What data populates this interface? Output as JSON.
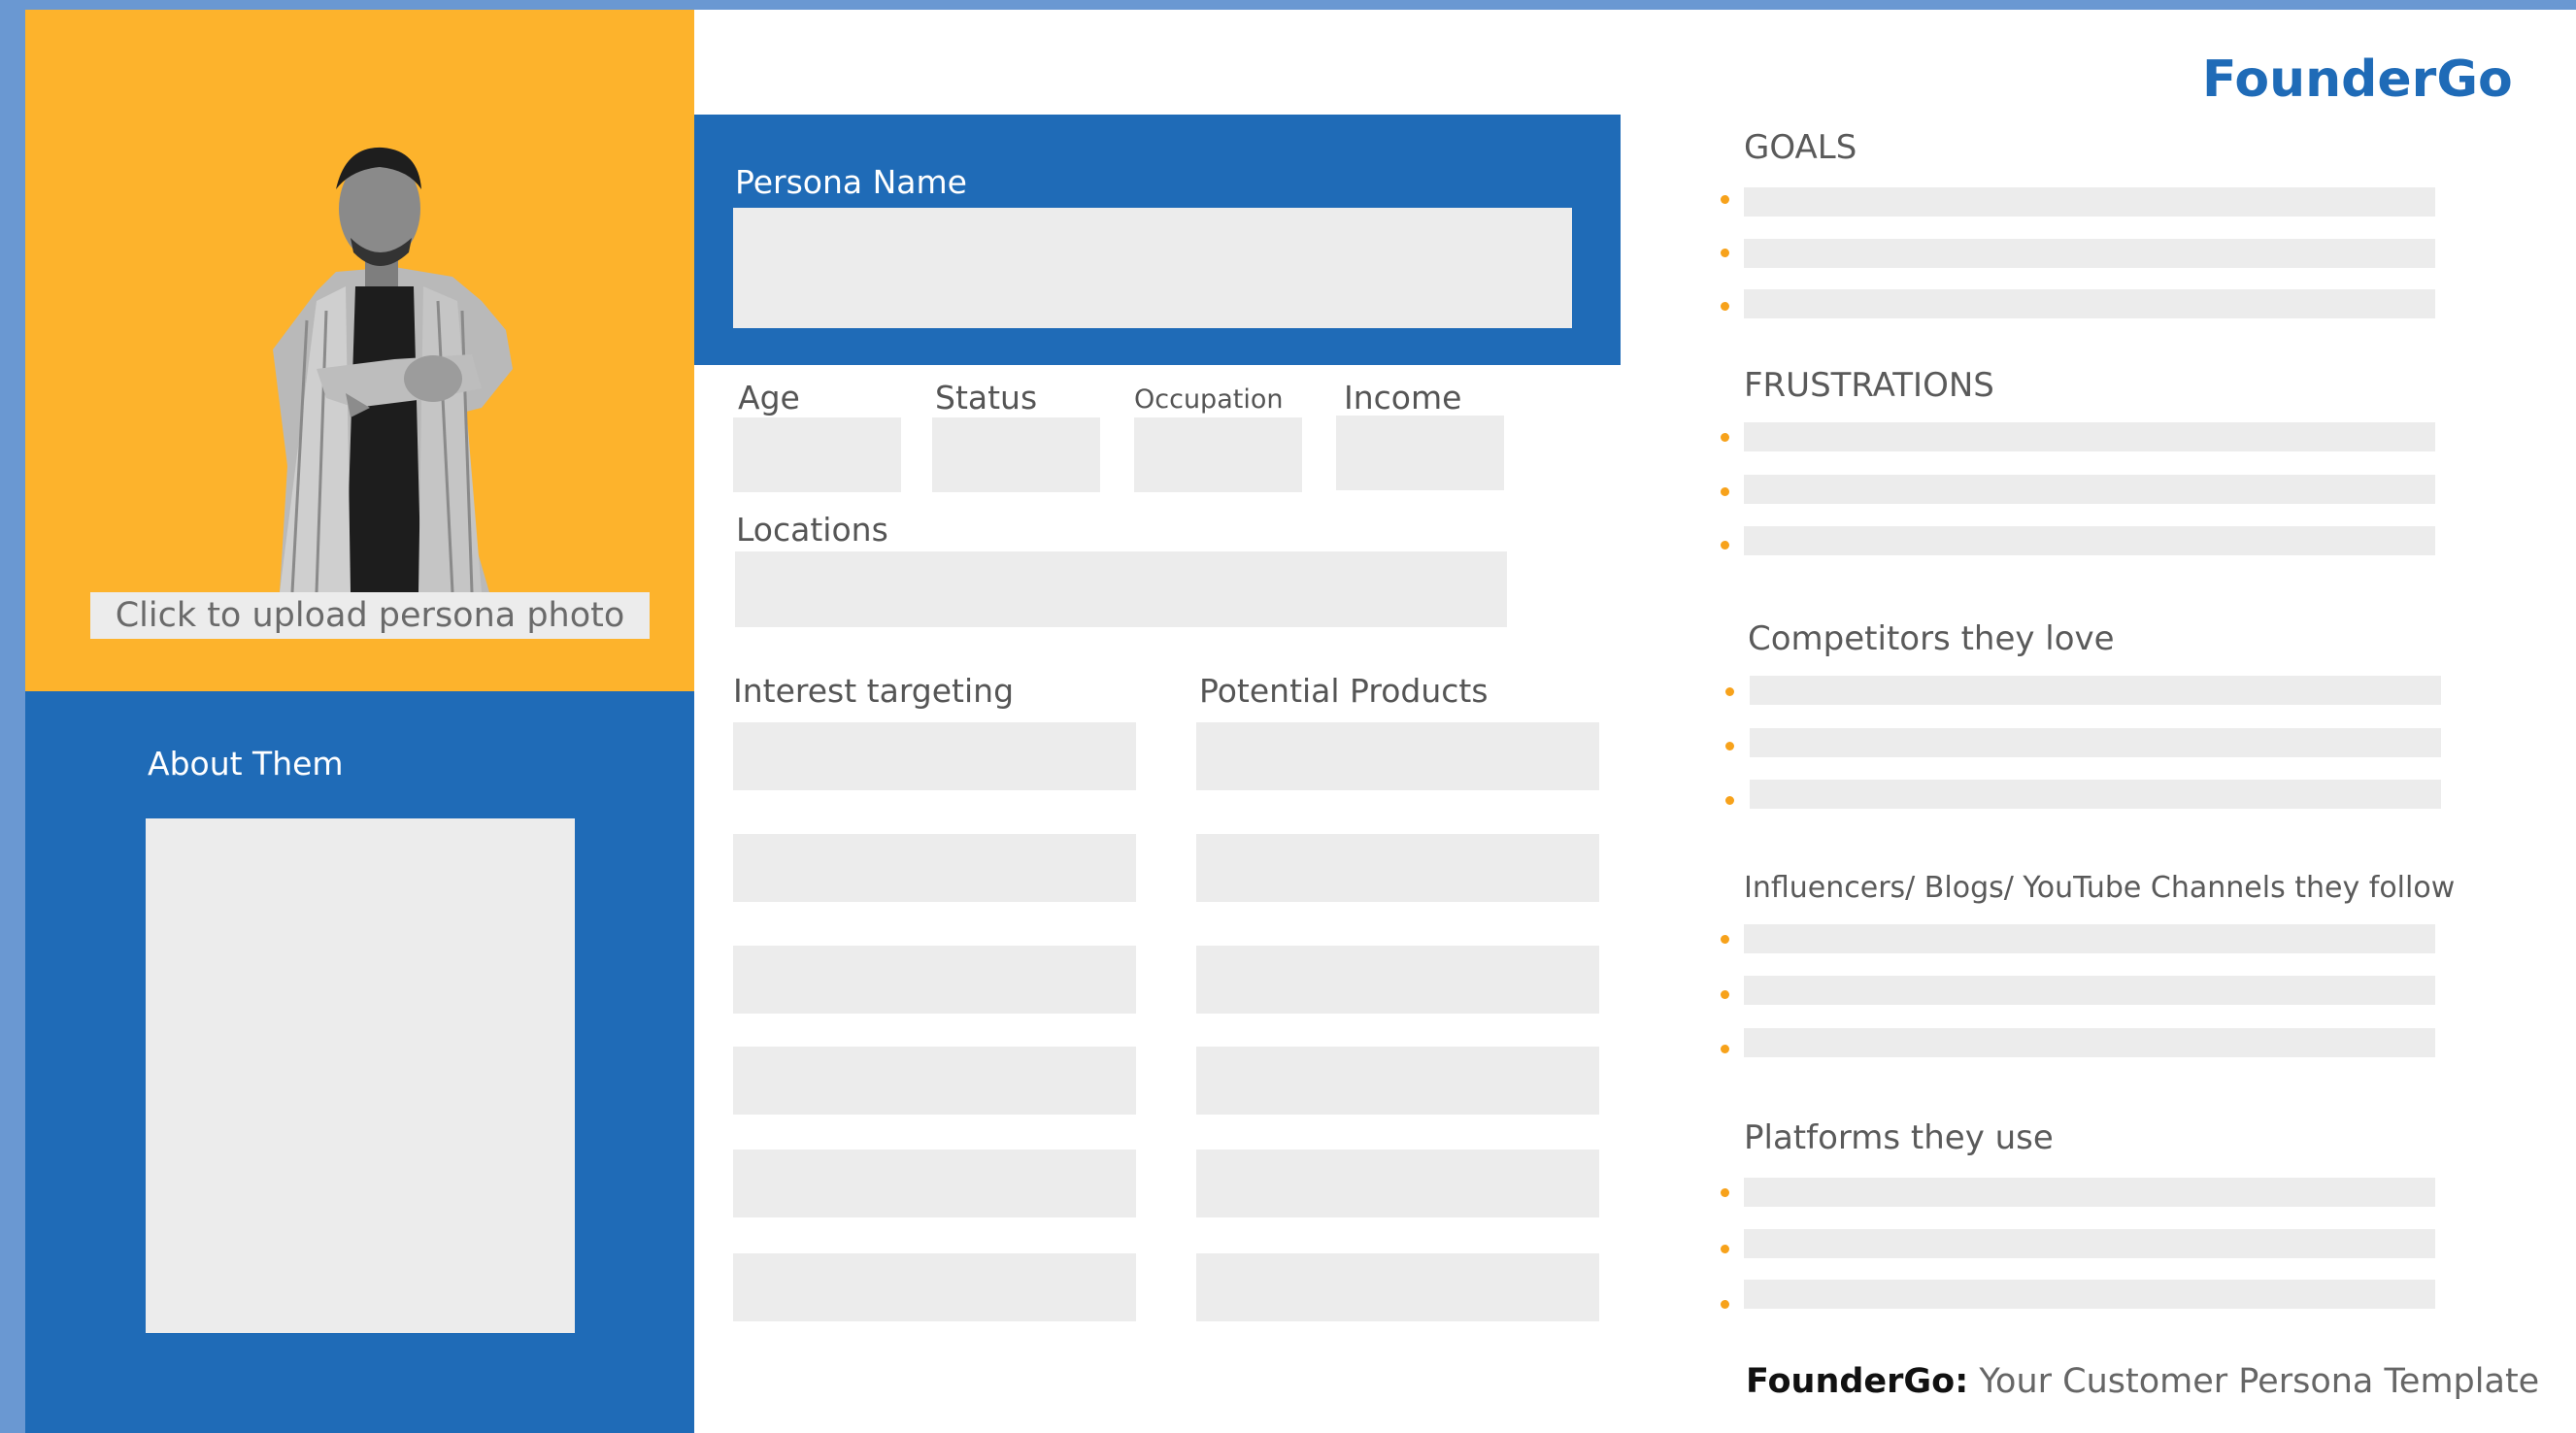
{
  "brand": {
    "logo": "FounderGo",
    "accent_color": "#1f6bb7",
    "photo_bg_color": "#fdb32c",
    "bullet_color": "#f7a21b"
  },
  "photo": {
    "upload_label": "Click to upload persona photo"
  },
  "about": {
    "label": "About Them"
  },
  "persona": {
    "name_label": "Persona Name",
    "name_value": ""
  },
  "demographics": {
    "age_label": "Age",
    "status_label": "Status",
    "occupation_label": "Occupation",
    "income_label": "Income",
    "locations_label": "Locations"
  },
  "lists": {
    "interest_label": "Interest targeting",
    "products_label": "Potential Products"
  },
  "sections": {
    "goals": "GOALS",
    "frustrations": "FRUSTRATIONS",
    "competitors": "Competitors they love",
    "influencers": "Influencers/ Blogs/ YouTube Channels they follow",
    "platforms": "Platforms they use"
  },
  "footer": {
    "brand": "FounderGo:",
    "text": " Your Customer Persona Template"
  }
}
